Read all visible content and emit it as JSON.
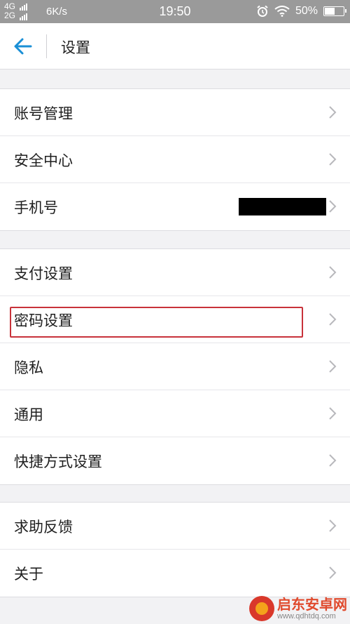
{
  "status_bar": {
    "network_top": "4G",
    "network_bottom": "2G",
    "speed": "6K/s",
    "time": "19:50",
    "battery": "50%",
    "battery_level": 0.5
  },
  "header": {
    "title": "设置"
  },
  "groups": [
    {
      "items": [
        {
          "label": "账号管理"
        },
        {
          "label": "安全中心"
        },
        {
          "label": "手机号",
          "value_masked": true
        }
      ]
    },
    {
      "items": [
        {
          "label": "支付设置"
        },
        {
          "label": "密码设置",
          "highlighted": true
        },
        {
          "label": "隐私"
        },
        {
          "label": "通用"
        },
        {
          "label": "快捷方式设置"
        }
      ]
    },
    {
      "items": [
        {
          "label": "求助反馈"
        },
        {
          "label": "关于"
        }
      ]
    }
  ],
  "watermark": {
    "name": "启东安卓网",
    "url": "www.qdhtdq.com"
  },
  "colors": {
    "accent": "#1a8fd6",
    "highlight_border": "#c8323a"
  }
}
